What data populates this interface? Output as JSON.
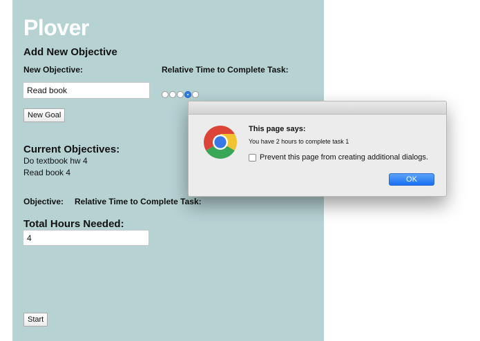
{
  "app": {
    "title": "Plover",
    "add_heading": "Add New Objective",
    "new_objective_label": "New Objective:",
    "relative_time_label": "Relative Time to Complete Task:",
    "objective_input_value": "Read book",
    "time_selected_index": 3,
    "new_goal_button": "New Goal",
    "current_heading": "Current Objectives:",
    "objectives": [
      "Do textbook hw 4",
      "Read book 4"
    ],
    "table_objective_header": "Objective:",
    "table_time_header": "Relative Time to Complete Task:",
    "total_hours_heading": "Total Hours Needed:",
    "total_hours_value": "4",
    "start_button": "Start"
  },
  "dialog": {
    "title": "This page says:",
    "message": "You have 2 hours to complete task 1",
    "checkbox_label": "Prevent this page from creating additional dialogs.",
    "checkbox_checked": false,
    "ok_button": "OK"
  },
  "icons": {
    "dialog_logo": "chrome-icon"
  },
  "colors": {
    "app_background": "#b6d2d3",
    "title_color": "#ffffff",
    "ok_button": "#1a6ff2",
    "radio_selected": "#2f7fe6"
  }
}
